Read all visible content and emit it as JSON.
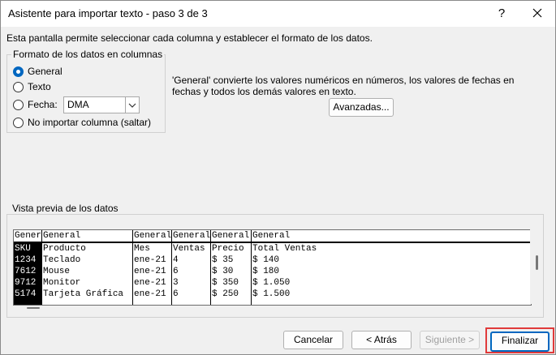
{
  "window": {
    "title": "Asistente para importar texto - paso 3 de 3",
    "help_glyph": "?"
  },
  "description": "Esta pantalla permite seleccionar cada columna y establecer el formato de los datos.",
  "format_group": {
    "title": "Formato de los datos en columnas",
    "options": [
      {
        "label": "General",
        "checked": true
      },
      {
        "label": "Texto",
        "checked": false
      },
      {
        "label": "Fecha:",
        "checked": false
      },
      {
        "label": "No importar columna (saltar)",
        "checked": false
      }
    ],
    "date_format": "DMA"
  },
  "info_text": "'General' convierte los valores numéricos en números, los valores de fechas en fechas y todos los demás valores en texto.",
  "advanced_button": "Avanzadas...",
  "preview": {
    "title": "Vista previa de los datos",
    "columns": [
      {
        "header": "General",
        "cells": [
          "SKU",
          "1234",
          "7612",
          "9712",
          "5174"
        ]
      },
      {
        "header": "General",
        "cells": [
          "Producto",
          "Teclado",
          "Mouse",
          "Monitor",
          "Tarjeta Gráfica"
        ]
      },
      {
        "header": "General",
        "cells": [
          "Mes",
          "ene-21",
          "ene-21",
          "ene-21",
          "ene-21"
        ]
      },
      {
        "header": "General",
        "cells": [
          "Ventas",
          "4",
          "6",
          "3",
          "6"
        ]
      },
      {
        "header": "General",
        "cells": [
          "Precio",
          "$ 35",
          "$ 30",
          "$ 350",
          "$ 250"
        ]
      },
      {
        "header": "General",
        "cells": [
          "Total Ventas",
          "$ 140",
          "$ 180",
          "$ 1.050",
          "$ 1.500"
        ]
      }
    ]
  },
  "buttons": {
    "cancel": "Cancelar",
    "back": "< Atrás",
    "next": "Siguiente >",
    "finish": "Finalizar"
  },
  "colors": {
    "accent": "#0067c0",
    "highlight": "#e03a3a"
  }
}
